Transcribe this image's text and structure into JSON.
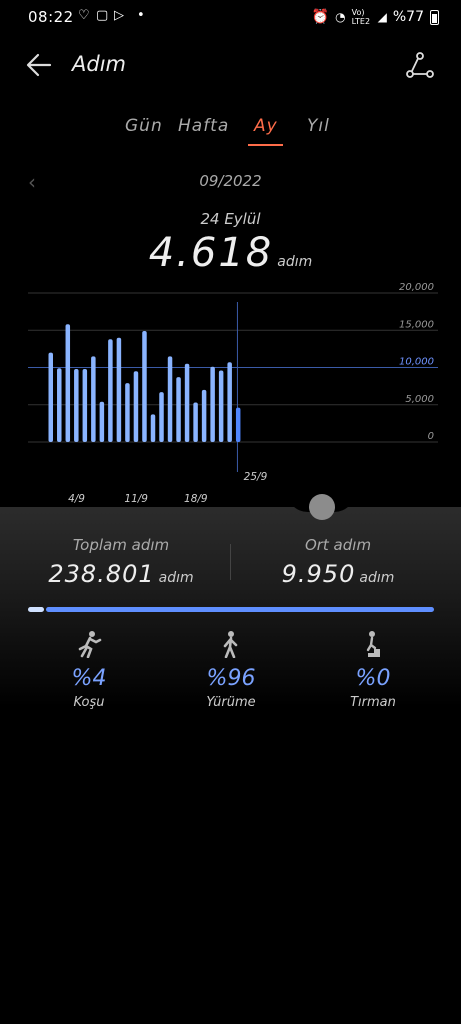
{
  "status_bar": {
    "time": "08:22",
    "network": "Vo) LTE2",
    "battery": "%77"
  },
  "header": {
    "title": "Adım"
  },
  "tabs": [
    {
      "label": "Gün",
      "active": false
    },
    {
      "label": "Hafta",
      "active": false
    },
    {
      "label": "Ay",
      "active": true
    },
    {
      "label": "Yıl",
      "active": false
    }
  ],
  "period": {
    "month": "09/2022"
  },
  "selection": {
    "date": "24 Eylül",
    "value": "4.618",
    "unit": "adım"
  },
  "chart_data": {
    "type": "bar",
    "x": [
      1,
      2,
      3,
      4,
      5,
      6,
      7,
      8,
      9,
      10,
      11,
      12,
      13,
      14,
      15,
      16,
      17,
      18,
      19,
      20,
      21,
      22,
      23,
      24
    ],
    "values": [
      12000,
      9900,
      15800,
      9800,
      9800,
      11500,
      5400,
      13800,
      14000,
      7900,
      9500,
      14900,
      3700,
      6700,
      11500,
      8700,
      10500,
      5300,
      7000,
      10100,
      9600,
      10700,
      4618
    ],
    "highlight_index": 22,
    "ylim": [
      0,
      20000
    ],
    "ytick_labels": [
      "20,000",
      "15,000",
      "10,000",
      "5,000",
      "0"
    ],
    "yticks": [
      20000,
      15000,
      10000,
      5000,
      0
    ],
    "average_line": 10000,
    "xtick_labels": [
      {
        "day": 4,
        "label": "4/9"
      },
      {
        "day": 11,
        "label": "11/9"
      },
      {
        "day": 18,
        "label": "18/9"
      },
      {
        "day": 25,
        "label": "25/9"
      }
    ],
    "bar_color": "#8ab4ff",
    "highlight_color": "#4f86ff"
  },
  "summary": {
    "total_label": "Toplam adım",
    "total_value": "238.801",
    "total_unit": "adım",
    "avg_label": "Ort adım",
    "avg_value": "9.950",
    "avg_unit": "adım"
  },
  "activities": [
    {
      "icon": "running-icon",
      "pct": "%4",
      "label": "Koşu"
    },
    {
      "icon": "walking-icon",
      "pct": "%96",
      "label": "Yürüme"
    },
    {
      "icon": "stairs-icon",
      "pct": "%0",
      "label": "Tırman"
    }
  ],
  "colors": {
    "accent": "#ff6d4a",
    "bar": "#8ab4ff",
    "highlight": "#4f86ff",
    "pct_text": "#7aa2ff"
  }
}
